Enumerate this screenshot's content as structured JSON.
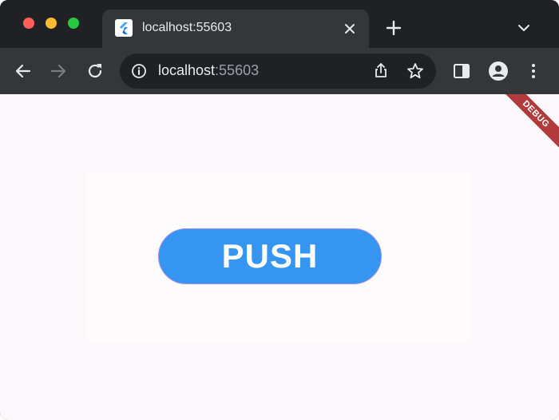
{
  "tab": {
    "title": "localhost:55603"
  },
  "address_bar": {
    "host": "localhost",
    "port": ":55603"
  },
  "icons": {
    "favicon": "flutter-logo-icon",
    "tab_close": "close-icon",
    "new_tab": "plus-icon",
    "tab_search": "chevron-down-icon",
    "back": "arrow-left-icon",
    "forward": "arrow-right-icon",
    "reload": "reload-icon",
    "site_info": "info-icon",
    "share": "share-icon",
    "bookmark": "star-icon",
    "side_panel": "side-panel-icon",
    "profile": "profile-icon",
    "menu": "kebab-menu-icon"
  },
  "app": {
    "button_label": "PUSH",
    "debug_banner": "DEBUG"
  },
  "colors": {
    "button": "#3595f0",
    "debug_banner": "#b13a3a",
    "page_background": "#fdf8fc",
    "chrome_dark": "#202124",
    "chrome_toolbar": "#35363a"
  }
}
